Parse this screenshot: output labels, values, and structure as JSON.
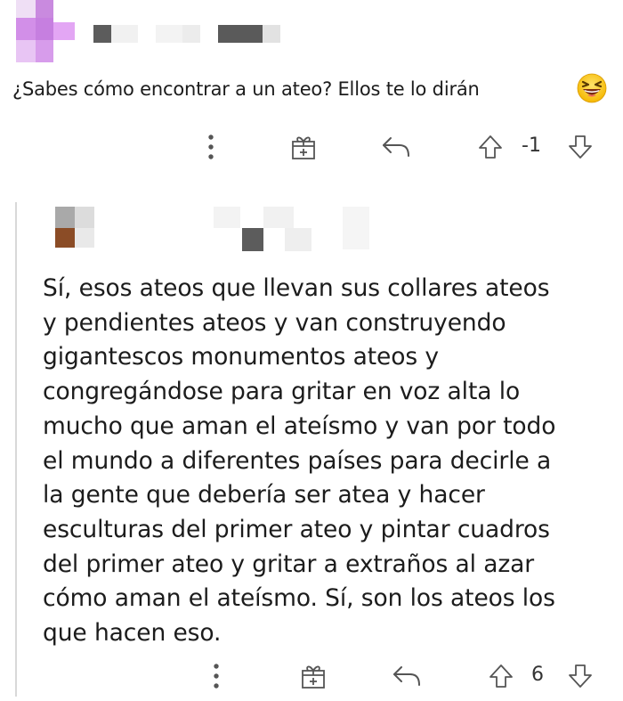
{
  "comments": [
    {
      "text": "¿Sabes cómo encontrar a un ateo? Ellos te lo dirán",
      "emoji": "laughing-face-emoji",
      "votes": "-1",
      "actions": [
        "more-icon",
        "gift-icon",
        "reply-icon",
        "upvote-icon",
        "downvote-icon"
      ]
    },
    {
      "text": "Sí, esos ateos que llevan sus collares ateos\ny pendientes ateos y van construyendo\ngigantescos monumentos ateos y\ncongregándose para gritar en voz alta lo\nmucho que aman el ateísmo y van por todo\nel mundo a diferentes países para decirle a\nla gente que debería ser atea y hacer\nesculturas del primer ateo y pintar cuadros\ndel primer ateo y gritar a extraños al azar\ncómo aman el ateísmo. Sí, son los ateos los\nque hacen eso.",
      "votes": "6",
      "actions": [
        "more-icon",
        "gift-icon",
        "reply-icon",
        "upvote-icon",
        "downvote-icon"
      ]
    }
  ],
  "colors": {
    "avatar_purple": "#d899ee",
    "avatar_brown": "#8b4c26",
    "pixel_dark": "#5c5c5c",
    "pixel_light": "#e8e8e8",
    "icon_stroke": "#555555"
  }
}
